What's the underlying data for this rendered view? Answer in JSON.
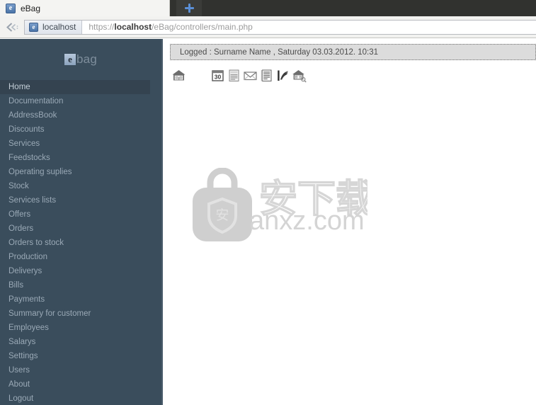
{
  "browser": {
    "tab": {
      "title": "eBag",
      "favicon_letter": "e",
      "favicon_name": "ebag-favicon"
    },
    "new_tab_label": "+",
    "back_label": "Back",
    "site_identity": {
      "name": "localhost",
      "favicon_letter": "e"
    },
    "url": {
      "scheme": "https://",
      "host": "localhost",
      "path": "/eBag/controllers/main.php",
      "full": "https://localhost/eBag/controllers/main.php"
    }
  },
  "sidebar": {
    "brand": {
      "badge": "e",
      "text": "bag"
    },
    "active_item": "Home",
    "items": [
      {
        "label": "Home",
        "name": "sidebar-item-home"
      },
      {
        "label": "Documentation",
        "name": "sidebar-item-documentation"
      },
      {
        "label": "AddressBook",
        "name": "sidebar-item-addressbook"
      },
      {
        "label": "Discounts",
        "name": "sidebar-item-discounts"
      },
      {
        "label": "Services",
        "name": "sidebar-item-services"
      },
      {
        "label": "Feedstocks",
        "name": "sidebar-item-feedstocks"
      },
      {
        "label": "Operating suplies",
        "name": "sidebar-item-operating-suplies"
      },
      {
        "label": "Stock",
        "name": "sidebar-item-stock"
      },
      {
        "label": "Services lists",
        "name": "sidebar-item-services-lists"
      },
      {
        "label": "Offers",
        "name": "sidebar-item-offers"
      },
      {
        "label": "Orders",
        "name": "sidebar-item-orders"
      },
      {
        "label": "Orders to stock",
        "name": "sidebar-item-orders-to-stock"
      },
      {
        "label": "Production",
        "name": "sidebar-item-production"
      },
      {
        "label": "Deliverys",
        "name": "sidebar-item-deliverys"
      },
      {
        "label": "Bills",
        "name": "sidebar-item-bills"
      },
      {
        "label": "Payments",
        "name": "sidebar-item-payments"
      },
      {
        "label": "Summary for customer",
        "name": "sidebar-item-summary-for-customer"
      },
      {
        "label": "Employees",
        "name": "sidebar-item-employees"
      },
      {
        "label": "Salarys",
        "name": "sidebar-item-salarys"
      },
      {
        "label": "Settings",
        "name": "sidebar-item-settings"
      },
      {
        "label": "Users",
        "name": "sidebar-item-users"
      },
      {
        "label": "About",
        "name": "sidebar-item-about"
      },
      {
        "label": "Logout",
        "name": "sidebar-item-logout"
      }
    ]
  },
  "main": {
    "status": {
      "text": "Logged :  Surname Name  ,  Saturday 03.03.2012. 10:31",
      "logged_label": "Logged :",
      "user": "Surname Name",
      "date": "Saturday 03.03.2012.",
      "time": "10:31"
    },
    "toolbar": [
      {
        "name": "home-icon",
        "title": "Home"
      },
      {
        "name": "calendar-icon",
        "title": "Calendar",
        "badge": "30"
      },
      {
        "name": "list-document-icon",
        "title": "List"
      },
      {
        "name": "envelope-icon",
        "title": "Mail"
      },
      {
        "name": "report-document-icon",
        "title": "Report"
      },
      {
        "name": "chart-icon",
        "title": "Statistics"
      },
      {
        "name": "home-search-icon",
        "title": "Find home"
      }
    ],
    "watermark": {
      "text": "anxz.com",
      "cjk": "安下载",
      "badge_char": "安"
    }
  },
  "colors": {
    "sidebar_bg": "#3a4d5c",
    "sidebar_active_bg": "#344350",
    "sidebar_text": "#9aa9b6",
    "status_bg": "#dcdcdc",
    "accent_blue": "#5b8fd6",
    "watermark_gray": "#d4d4d4"
  }
}
